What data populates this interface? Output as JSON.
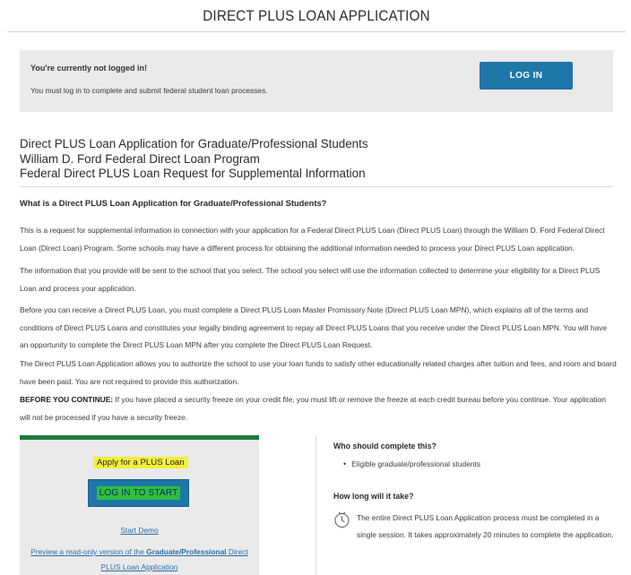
{
  "page": {
    "title": "DIRECT PLUS LOAN APPLICATION"
  },
  "login_notice": {
    "title": "You're currently not logged in!",
    "message": "You must log in to complete and submit federal student loan processes.",
    "button_label": "LOG IN"
  },
  "headings": [
    "Direct PLUS Loan Application for Graduate/Professional Students",
    "William D. Ford Federal Direct Loan Program",
    "Federal Direct PLUS Loan Request for Supplemental Information"
  ],
  "section": {
    "heading": "What is a Direct PLUS Loan Application for Graduate/Professional Students?",
    "paragraphs": [
      "This is a request for supplemental information in connection with your application for a Federal Direct PLUS Loan (Direct PLUS Loan) through the William D. Ford Federal Direct Loan (Direct Loan) Program. Some schools may have a different process for obtaining the additional information needed to process your Direct PLUS Loan application.",
      "The information that you provide will be sent to the school that you select. The school you select will use the information collected to determine your eligibility for a Direct PLUS Loan and process your application.",
      "Before you can receive a Direct PLUS Loan, you must complete a Direct PLUS Loan Master Promissory Note (Direct PLUS Loan MPN), which explains all of the terms and conditions of Direct PLUS Loans and constitutes your legally binding agreement to repay all Direct PLUS Loans that you receive under the Direct PLUS Loan MPN. You will have an opportunity to complete the Direct PLUS Loan MPN after you complete the Direct PLUS Loan Request.",
      "The Direct PLUS Loan Application allows you to authorize the school to use your loan funds to satisfy other educationally related charges after tuition and fees, and room and board have been paid. You are not required to provide this authorization."
    ],
    "warning_label": "BEFORE YOU CONTINUE:",
    "warning_text": " If you have placed a security freeze on your credit file, you must lift or remove the freeze at each credit bureau before you continue. Your application will not be processed if you have a security freeze."
  },
  "apply_card": {
    "heading": "Apply for a PLUS Loan",
    "button_label": "LOG IN TO START",
    "demo_link": "Start Demo",
    "preview_prefix": "Preview a read-only version of the ",
    "preview_bold": "Graduate/Professional",
    "preview_suffix": " Direct PLUS Loan Application"
  },
  "sidebar": {
    "who_heading": "Who should complete this?",
    "who_items": [
      "Eligible graduate/professional students"
    ],
    "how_heading": "How long will it take?",
    "how_text": "The entire Direct PLUS Loan Application process must be completed in a single session. It takes approximately 20 minutes to complete the application.",
    "how_icon": "clock-icon"
  },
  "colors": {
    "button_blue": "#1f76a8",
    "card_top_green": "#1f7a3d",
    "highlight_yellow": "#f5ee3a",
    "highlight_green": "#2fbf3e",
    "link_blue": "#2a6fa8",
    "panel_gray": "#eaeaea"
  }
}
